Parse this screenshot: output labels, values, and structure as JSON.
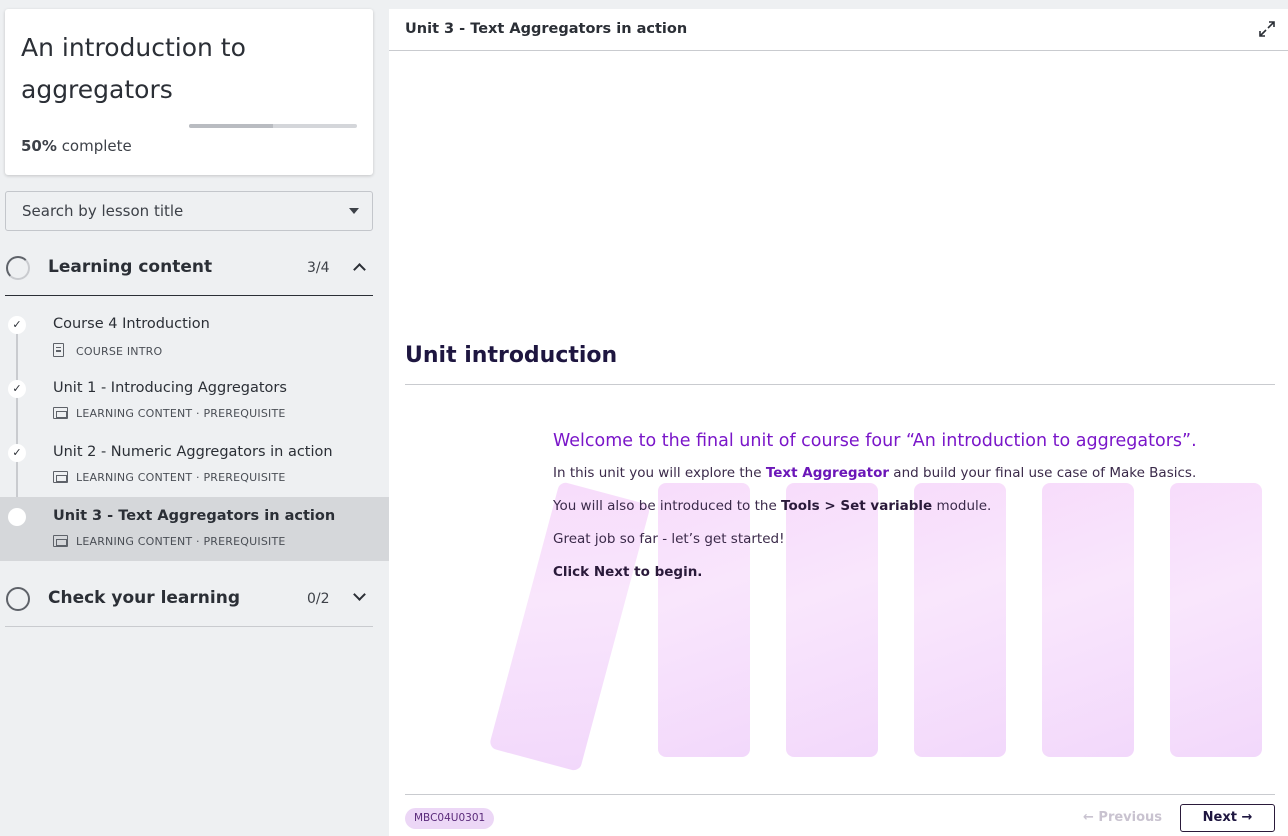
{
  "course": {
    "title": "An introduction to aggregators",
    "progress_percent": 50,
    "progress_percent_label": "50%",
    "progress_suffix": "complete"
  },
  "search": {
    "placeholder": "Search by lesson title"
  },
  "sections": [
    {
      "title": "Learning content",
      "count": "3/4",
      "expanded": true,
      "lessons": [
        {
          "title": "Course 4 Introduction",
          "meta": "COURSE INTRO",
          "icon": "document-icon",
          "status": "completed"
        },
        {
          "title": "Unit 1 - Introducing Aggregators",
          "meta": "LEARNING CONTENT · PREREQUISITE",
          "icon": "slides-icon",
          "status": "completed"
        },
        {
          "title": "Unit 2 - Numeric Aggregators in action",
          "meta": "LEARNING CONTENT · PREREQUISITE",
          "icon": "slides-icon",
          "status": "completed"
        },
        {
          "title": "Unit 3 - Text Aggregators in action",
          "meta": "LEARNING CONTENT · PREREQUISITE",
          "icon": "slides-icon",
          "status": "current"
        }
      ]
    },
    {
      "title": "Check your learning",
      "count": "0/2",
      "expanded": false
    }
  ],
  "main": {
    "title": "Unit 3 - Text Aggregators in action",
    "heading": "Unit introduction",
    "welcome": "Welcome to the final unit of course four “An introduction to aggregators”.",
    "p1_a": "In this unit you will explore the ",
    "p1_hl": "Text Aggregator",
    "p1_b": " and build your final use case of Make Basics.",
    "p2_a": "You will also be introduced to the ",
    "p2_bold": "Tools > Set variable",
    "p2_b": " module.",
    "p3": "Great job so far - let’s get started!",
    "p4": "Click Next to begin.",
    "code": "MBC04U0301",
    "prev_label": "← Previous",
    "next_label": "Next →"
  },
  "colors": {
    "accent_purple": "#7a16c9",
    "heading_dark": "#1e1640",
    "decor_pink": "#f7dcfb"
  }
}
